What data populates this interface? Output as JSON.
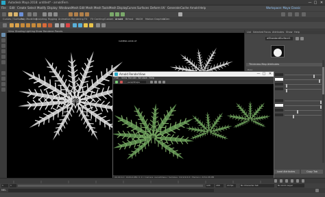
{
  "window": {
    "title": "Autodesk Maya 2018: untitled* - arnoldFern",
    "controls": [
      "—",
      "□",
      "✕"
    ]
  },
  "menubar": {
    "items": [
      "File",
      "Edit",
      "Create",
      "Select",
      "Modify",
      "Display",
      "Windows",
      "Mesh",
      "Edit Mesh",
      "Mesh Tools",
      "Mesh Display",
      "Curves",
      "Surfaces",
      "Deform",
      "UV",
      "Generate",
      "Cache",
      "Arnold",
      "Help"
    ],
    "workspace": "Workspace: Maya Classic"
  },
  "shelf": {
    "tabs": [
      "Curves / Surfaces",
      "Poly Modeling",
      "Sculpting",
      "Rigging",
      "Animation",
      "Rendering",
      "FX",
      "FX Caching",
      "Custom",
      "Arnold",
      "Bifrost",
      "MASH",
      "Motion Graphics",
      "XGen"
    ]
  },
  "viewport": {
    "menu": [
      "View",
      "Shading",
      "Lighting",
      "Show",
      "Renderer",
      "Panels"
    ],
    "label": "CAMERA LOOK AT"
  },
  "attribute_editor": {
    "tabs": [
      "List",
      "Selected",
      "Focus",
      "Attributes",
      "Show",
      "Help"
    ],
    "node_name": "aiStandardSurface1",
    "section": "Thickness Map Attributes",
    "rows": [
      "Base",
      "Weight",
      "Color",
      "Diffuse Roughness",
      "Metalness",
      "Specular",
      "Weight",
      "Color",
      "Roughness",
      "IOR"
    ],
    "buttons": [
      "Select",
      "Load Attributes",
      "Copy Tab"
    ]
  },
  "arnold_view": {
    "title": "Arnold RenderView",
    "menu": [
      "File",
      "View",
      "Render",
      "Window",
      "Help"
    ],
    "camera": "perspShape",
    "status": "00:00:12 | 1920x1080 (1:1) | Camera: perspShape | Samples: 3/2/2/2/2/2 | Memory: 2154.38 MB"
  },
  "timeslider": {
    "start": "1",
    "end": "120",
    "range_start": "1",
    "range_end": "200",
    "fps": "24 fps",
    "character_set": "No Character Set",
    "anim_layer": "No Anim Layer"
  },
  "cmdline": {
    "label": "MEL"
  },
  "colors": {
    "ui_bg": "#444444",
    "viewport_bg": "#000000",
    "fern_preview": "#d8d8d8",
    "fern_render": "#4f7a43",
    "maya_accent": "#2aa9c9"
  }
}
